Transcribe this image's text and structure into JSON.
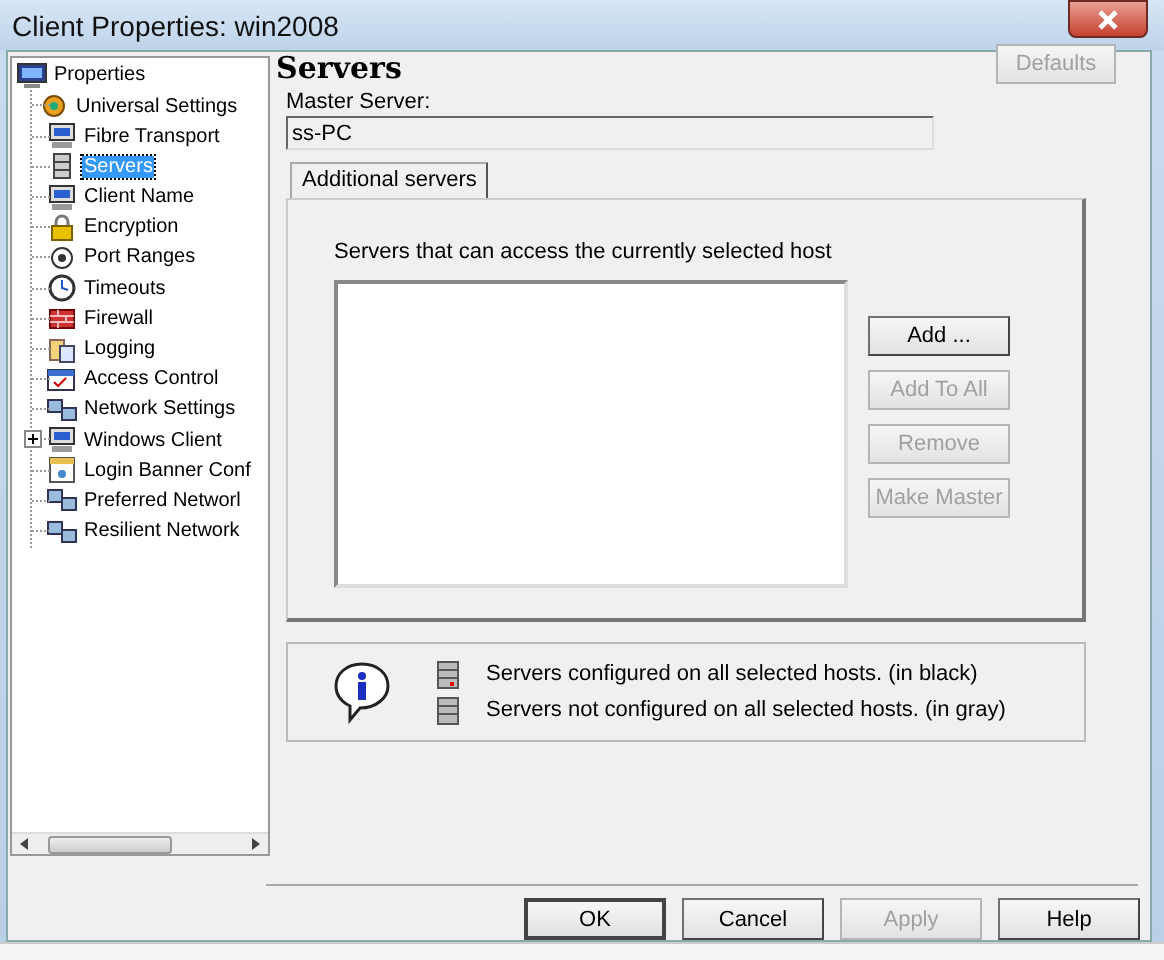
{
  "window": {
    "title": "Client Properties: win2008"
  },
  "tree": {
    "label": "Properties",
    "children": [
      {
        "label": "Universal Settings",
        "selected": false,
        "expander": false
      },
      {
        "label": "Fibre Transport",
        "selected": false,
        "expander": false
      },
      {
        "label": "Servers",
        "selected": true,
        "expander": false
      },
      {
        "label": "Client Name",
        "selected": false,
        "expander": false
      },
      {
        "label": "Encryption",
        "selected": false,
        "expander": false
      },
      {
        "label": "Port Ranges",
        "selected": false,
        "expander": false
      },
      {
        "label": "Timeouts",
        "selected": false,
        "expander": false
      },
      {
        "label": "Firewall",
        "selected": false,
        "expander": false
      },
      {
        "label": "Logging",
        "selected": false,
        "expander": false
      },
      {
        "label": "Access Control",
        "selected": false,
        "expander": false
      },
      {
        "label": "Network Settings",
        "selected": false,
        "expander": false
      },
      {
        "label": "Windows Client",
        "selected": false,
        "expander": true
      },
      {
        "label": "Login Banner Conf",
        "selected": false,
        "expander": false
      },
      {
        "label": "Preferred Networl",
        "selected": false,
        "expander": false
      },
      {
        "label": "Resilient Network",
        "selected": false,
        "expander": false
      }
    ]
  },
  "page": {
    "heading": "Servers",
    "defaults_button": {
      "label": "Defaults",
      "disabled": true
    },
    "master_server": {
      "label": "Master Server:",
      "value": "ss-PC"
    },
    "tab": {
      "label": "Additional servers"
    },
    "list_label": "Servers that can access the currently selected host",
    "list_buttons": [
      {
        "label": "Add ...",
        "disabled": false
      },
      {
        "label": "Add To All",
        "disabled": true
      },
      {
        "label": "Remove",
        "disabled": true
      },
      {
        "label": "Make Master",
        "disabled": true
      }
    ],
    "legend": [
      {
        "kind": "configured",
        "text": "Servers configured on all selected hosts. (in black)"
      },
      {
        "kind": "not-configured",
        "text": "Servers not configured on all selected hosts. (in gray)"
      }
    ]
  },
  "buttons": [
    {
      "label": "OK",
      "disabled": false
    },
    {
      "label": "Cancel",
      "disabled": false
    },
    {
      "label": "Apply",
      "disabled": true
    },
    {
      "label": "Help",
      "disabled": false
    }
  ]
}
